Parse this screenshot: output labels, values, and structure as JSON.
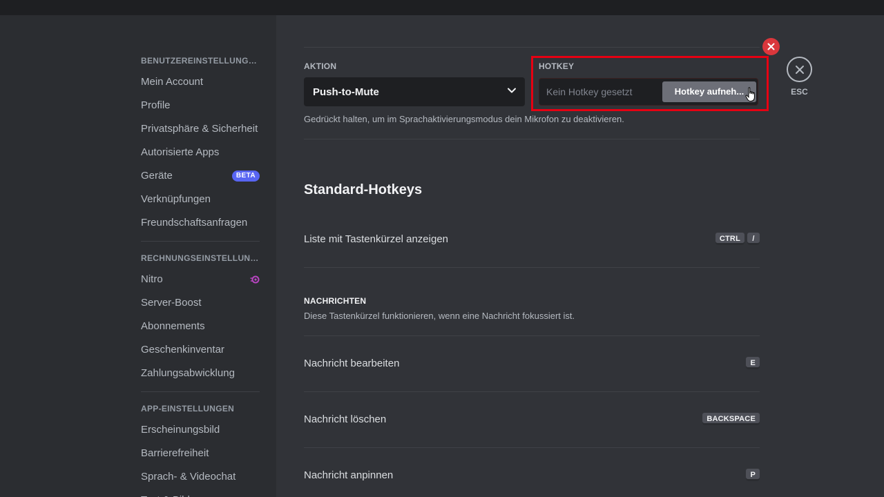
{
  "sidebar": {
    "sections": [
      {
        "header": "Benutzereinstellungen",
        "items": [
          {
            "label": "Mein Account"
          },
          {
            "label": "Profile"
          },
          {
            "label": "Privatsphäre & Sicherheit"
          },
          {
            "label": "Autorisierte Apps"
          },
          {
            "label": "Geräte",
            "badge": "BETA"
          },
          {
            "label": "Verknüpfungen"
          },
          {
            "label": "Freundschaftsanfragen"
          }
        ]
      },
      {
        "header": "Rechnungseinstellungen",
        "items": [
          {
            "label": "Nitro",
            "icon": "nitro-icon"
          },
          {
            "label": "Server-Boost"
          },
          {
            "label": "Abonnements"
          },
          {
            "label": "Geschenkinventar"
          },
          {
            "label": "Zahlungsabwicklung"
          }
        ]
      },
      {
        "header": "App-Einstellungen",
        "items": [
          {
            "label": "Erscheinungsbild"
          },
          {
            "label": "Barrierefreiheit"
          },
          {
            "label": "Sprach- & Videochat"
          },
          {
            "label": "Text & Bilder"
          }
        ]
      }
    ]
  },
  "keybind": {
    "action_label": "Aktion",
    "action_value": "Push-to-Mute",
    "hotkey_label": "Hotkey",
    "hotkey_placeholder": "Kein Hotkey gesetzt",
    "record_button": "Hotkey aufneh...",
    "description": "Gedrückt halten, um im Sprachaktivierungsmodus dein Mikrofon zu deaktivieren."
  },
  "close": {
    "esc_label": "ESC"
  },
  "defaults": {
    "title": "Standard-Hotkeys",
    "list_shortcuts": {
      "label": "Liste mit Tastenkürzel anzeigen",
      "keys": [
        "CTRL",
        "/"
      ]
    },
    "messages": {
      "header": "Nachrichten",
      "description": "Diese Tastenkürzel funktionieren, wenn eine Nachricht fokussiert ist.",
      "rows": [
        {
          "label": "Nachricht bearbeiten",
          "keys": [
            "E"
          ]
        },
        {
          "label": "Nachricht löschen",
          "keys": [
            "BACKSPACE"
          ]
        },
        {
          "label": "Nachricht anpinnen",
          "keys": [
            "P"
          ]
        }
      ]
    }
  },
  "colors": {
    "accent": "#5865f2",
    "danger": "#da373c",
    "highlight_frame": "#e60012",
    "nitro": "#b845c1"
  }
}
